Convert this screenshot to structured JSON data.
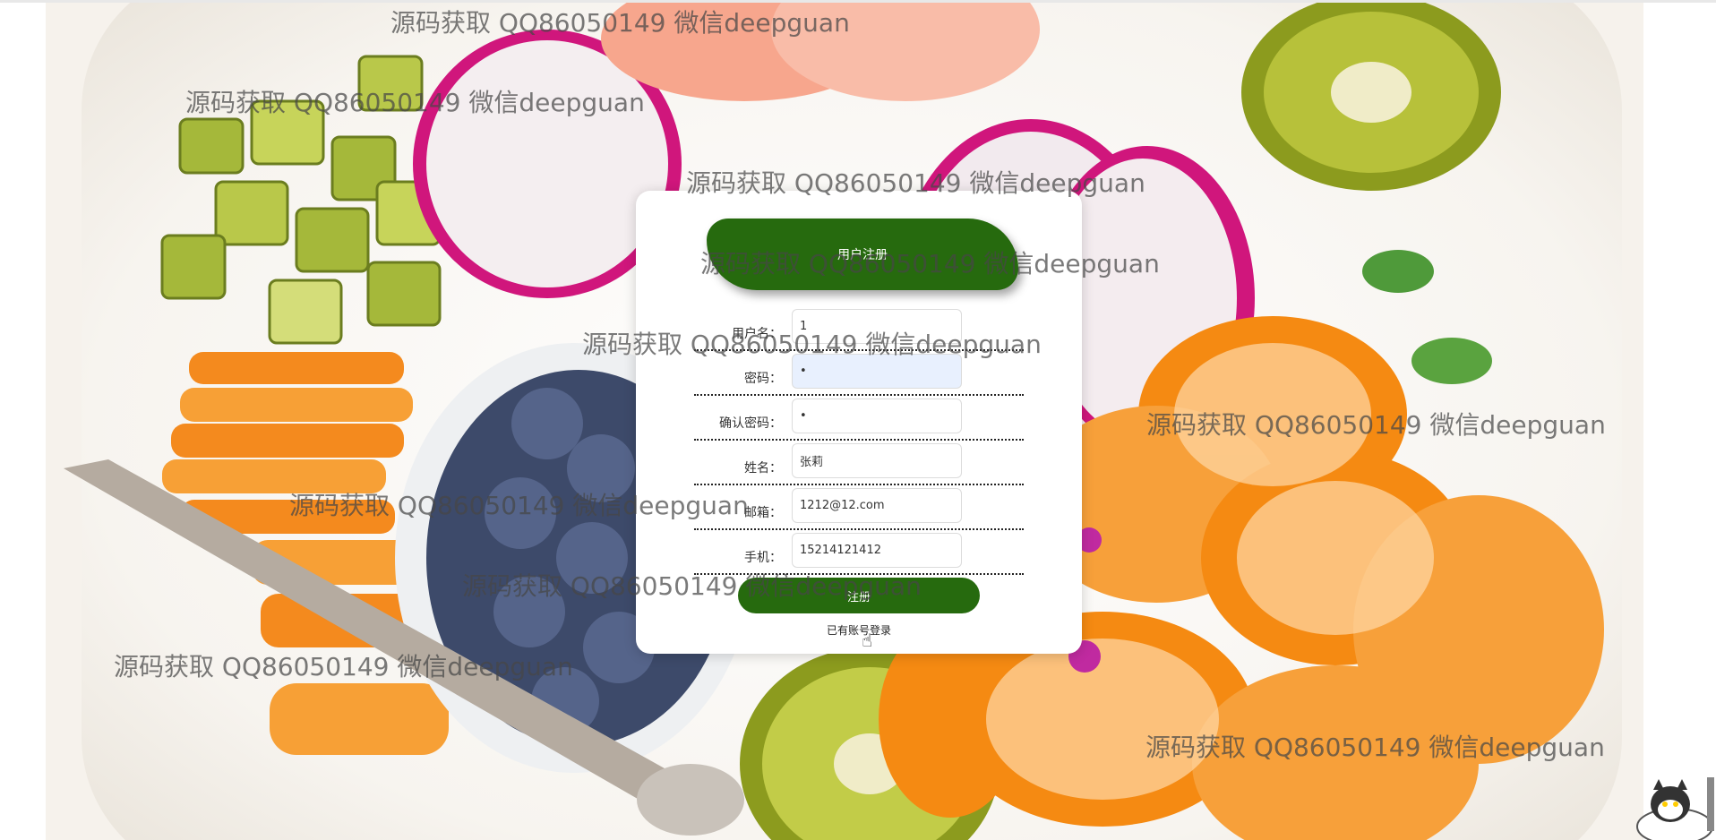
{
  "form": {
    "title": "用户注册",
    "fields": [
      {
        "label": "用户名：",
        "value": "1"
      },
      {
        "label": "密码：",
        "value": "•"
      },
      {
        "label": "确认密码：",
        "value": "•"
      },
      {
        "label": "姓名：",
        "value": "张莉"
      },
      {
        "label": "邮箱：",
        "value": "1212@12.com"
      },
      {
        "label": "手机：",
        "value": "15214121412"
      }
    ],
    "submit_label": "注册",
    "login_link": "已有账号登录"
  },
  "watermark": "源码获取 QQ86050149 微信deepguan",
  "colors": {
    "accent": "#266a0e",
    "focused_input": "#e8f0fe"
  },
  "icons": [
    "hand-pointer-icon",
    "mascot-icon"
  ]
}
